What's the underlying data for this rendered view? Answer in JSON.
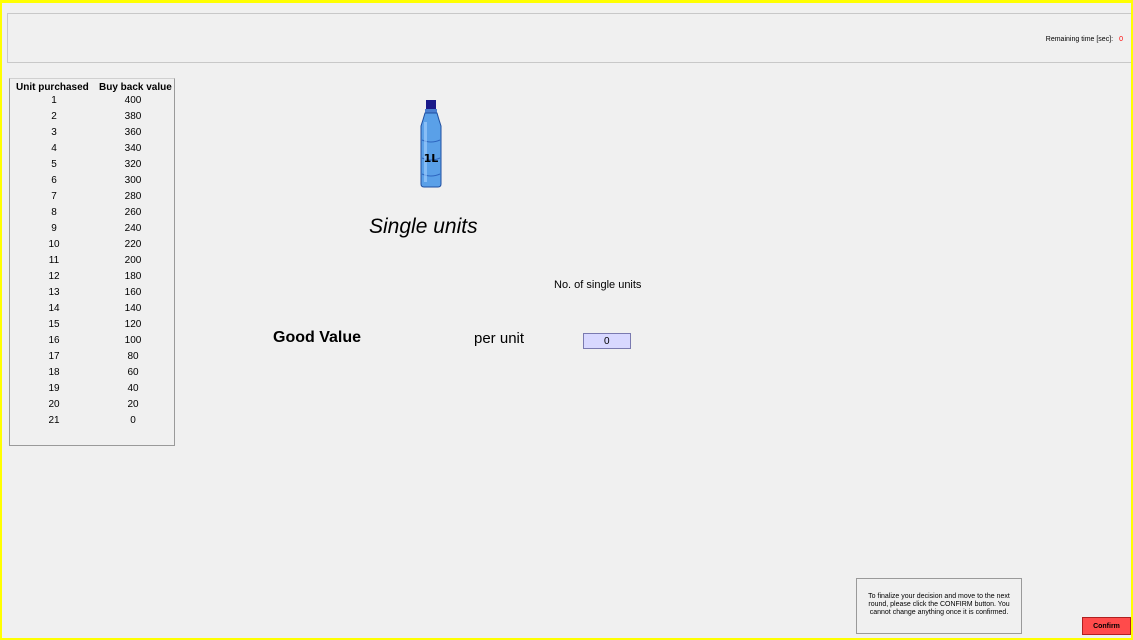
{
  "header": {
    "remaining_time_label": "Remaining time [sec]:",
    "remaining_time_value": "0"
  },
  "table": {
    "headers": [
      "Unit purchased",
      "Buy back value"
    ],
    "rows": [
      [
        "1",
        "400"
      ],
      [
        "2",
        "380"
      ],
      [
        "3",
        "360"
      ],
      [
        "4",
        "340"
      ],
      [
        "5",
        "320"
      ],
      [
        "6",
        "300"
      ],
      [
        "7",
        "280"
      ],
      [
        "8",
        "260"
      ],
      [
        "9",
        "240"
      ],
      [
        "10",
        "220"
      ],
      [
        "11",
        "200"
      ],
      [
        "12",
        "180"
      ],
      [
        "13",
        "160"
      ],
      [
        "14",
        "140"
      ],
      [
        "15",
        "120"
      ],
      [
        "16",
        "100"
      ],
      [
        "17",
        "80"
      ],
      [
        "18",
        "60"
      ],
      [
        "19",
        "40"
      ],
      [
        "20",
        "20"
      ],
      [
        "21",
        "0"
      ]
    ]
  },
  "product": {
    "bottle_icon": "water-bottle-1l-icon",
    "bottle_label": "1L",
    "title": "Single units",
    "quantity_label": "No. of single units",
    "price_label": "Good Value",
    "per_unit_label": "per unit",
    "quantity_value": "0"
  },
  "footer": {
    "instructions": "To finalize your decision and move to the next round, please click the CONFIRM button. You cannot change anything once it is confirmed.",
    "confirm_label": "Confirm"
  },
  "colors": {
    "frame": "#ffff00",
    "confirm_button": "#ff4b4b",
    "timer_value": "#ff0000",
    "input_background": "#d8d8ff"
  }
}
